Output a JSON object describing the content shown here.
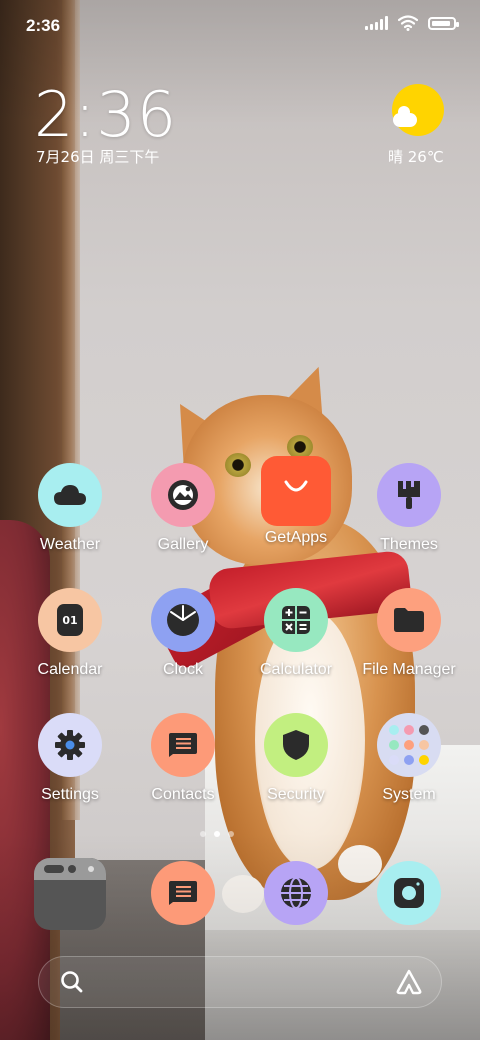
{
  "status_bar": {
    "time": "2:36",
    "battery_level": 0.9
  },
  "clock_widget": {
    "time": "2:36",
    "date": "7月26日 周三下午"
  },
  "weather_widget": {
    "text": "晴 26℃",
    "icon": "sun-cloud-icon"
  },
  "apps": [
    {
      "label": "Weather",
      "icon": "cloud-icon",
      "color": "#a8eef0"
    },
    {
      "label": "Gallery",
      "icon": "gallery-icon",
      "color": "#f49bb0"
    },
    {
      "label": "GetApps",
      "icon": "shopping-bag-icon",
      "color": "#ff5a35"
    },
    {
      "label": "Themes",
      "icon": "paintbrush-icon",
      "color": "#b7a4f5"
    },
    {
      "label": "Calendar",
      "icon": "calendar-icon",
      "color": "#f7c6a3",
      "badge": "01"
    },
    {
      "label": "Clock",
      "icon": "clock-icon",
      "color": "#8ea1f2"
    },
    {
      "label": "Calculator",
      "icon": "calculator-icon",
      "color": "#97e8c0"
    },
    {
      "label": "File Manager",
      "icon": "folder-icon",
      "color": "#fda07e"
    },
    {
      "label": "Settings",
      "icon": "gear-icon",
      "color": "#dadcf8"
    },
    {
      "label": "Contacts",
      "icon": "contacts-icon",
      "color": "#fd9a78"
    },
    {
      "label": "Security",
      "icon": "shield-icon",
      "color": "#c2ef80"
    },
    {
      "label": "System",
      "icon": "folder-grid-icon",
      "color": "#d8dcf2"
    }
  ],
  "page_indicator": {
    "pages": 2,
    "current": 1
  },
  "dock": [
    {
      "icon": "phone-dialer-icon",
      "color": "#555555"
    },
    {
      "icon": "messages-icon",
      "color": "#fd9a78"
    },
    {
      "icon": "browser-globe-icon",
      "color": "#b7a4f5"
    },
    {
      "icon": "camera-icon",
      "color": "#a8eef0"
    }
  ],
  "search_bar": {
    "search_icon": "search-icon",
    "assistant_icon": "assistant-icon"
  }
}
